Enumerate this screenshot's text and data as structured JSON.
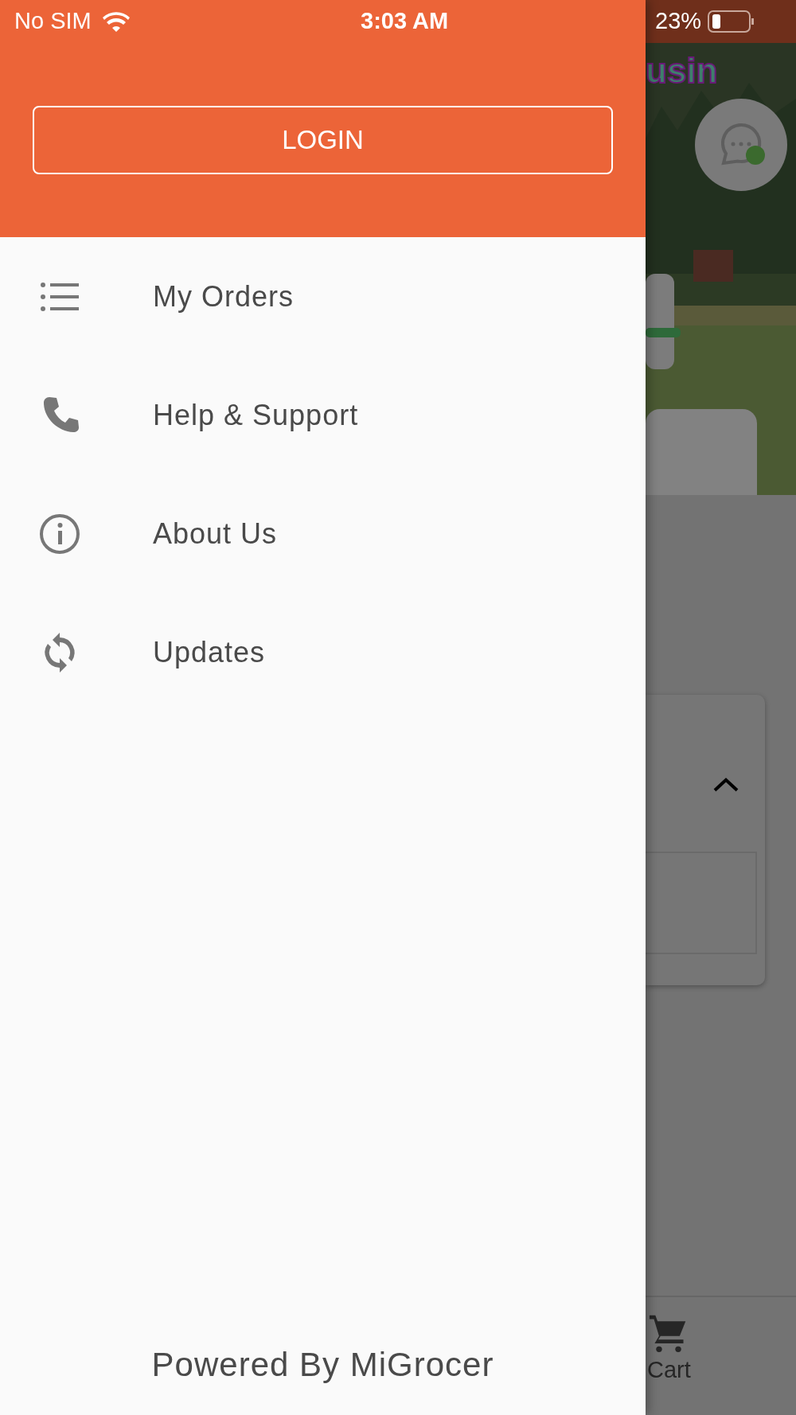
{
  "status_bar": {
    "carrier": "No SIM",
    "time": "3:03 AM",
    "battery": "23%"
  },
  "drawer": {
    "login_button": "LOGIN",
    "menu": [
      {
        "label": "My Orders",
        "kind": "list"
      },
      {
        "label": "Help & Support",
        "kind": "phone"
      },
      {
        "label": "About Us",
        "kind": "info"
      },
      {
        "label": "Updates",
        "kind": "sync"
      }
    ],
    "footer": "Powered By MiGrocer"
  },
  "background": {
    "logo_text": "usin",
    "chat_online": true,
    "nav": [
      {
        "label": "Cart",
        "kind": "cart"
      }
    ]
  }
}
